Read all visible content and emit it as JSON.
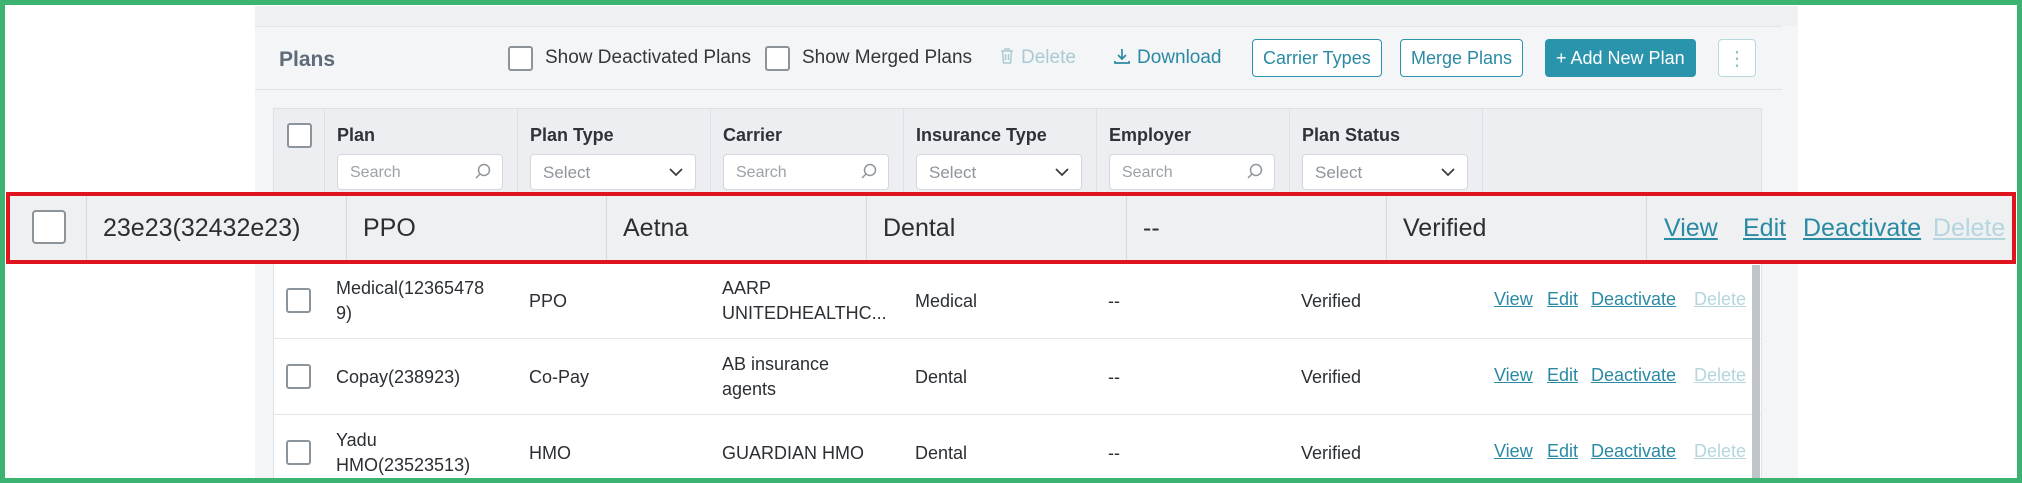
{
  "toolbar": {
    "title": "Plans",
    "show_deactivated_label": "Show Deactivated Plans",
    "show_merged_label": "Show Merged Plans",
    "delete_label": "Delete",
    "download_label": "Download",
    "carrier_types_label": "Carrier Types",
    "merge_plans_label": "Merge Plans",
    "add_new_plan_label": "+ Add New Plan",
    "more_label": "⋮"
  },
  "columns": {
    "plan": {
      "title": "Plan",
      "placeholder": "Search"
    },
    "plan_type": {
      "title": "Plan Type",
      "placeholder": "Select"
    },
    "carrier": {
      "title": "Carrier",
      "placeholder": "Search"
    },
    "insurance_type": {
      "title": "Insurance Type",
      "placeholder": "Select"
    },
    "employer": {
      "title": "Employer",
      "placeholder": "Search"
    },
    "plan_status": {
      "title": "Plan Status",
      "placeholder": "Select"
    }
  },
  "highlighted_row": {
    "plan": "23e23(32432e23)",
    "plan_type": "PPO",
    "carrier": "Aetna",
    "insurance_type": "Dental",
    "employer": "--",
    "status": "Verified",
    "actions": {
      "view": "View",
      "edit": "Edit",
      "deactivate": "Deactivate",
      "delete": "Delete"
    }
  },
  "rows": [
    {
      "plan": "Medical(12365478 9)",
      "plan_type": "PPO",
      "carrier": "AARP UNITEDHEALTHC...",
      "insurance_type": "Medical",
      "employer": "--",
      "status": "Verified",
      "actions": {
        "view": "View",
        "edit": "Edit",
        "deactivate": "Deactivate",
        "delete": "Delete"
      }
    },
    {
      "plan": "Copay(238923)",
      "plan_type": "Co-Pay",
      "carrier": "AB insurance agents",
      "insurance_type": "Dental",
      "employer": "--",
      "status": "Verified",
      "actions": {
        "view": "View",
        "edit": "Edit",
        "deactivate": "Deactivate",
        "delete": "Delete"
      }
    },
    {
      "plan": "Yadu HMO(23523513)",
      "plan_type": "HMO",
      "carrier": "GUARDIAN HMO",
      "insurance_type": "Dental",
      "employer": "--",
      "status": "Verified",
      "actions": {
        "view": "View",
        "edit": "Edit",
        "deactivate": "Deactivate",
        "delete": "Delete"
      }
    }
  ],
  "colors": {
    "accent": "#2a94ad",
    "highlight_border": "#e0141e",
    "frame_border": "#3cb371"
  }
}
